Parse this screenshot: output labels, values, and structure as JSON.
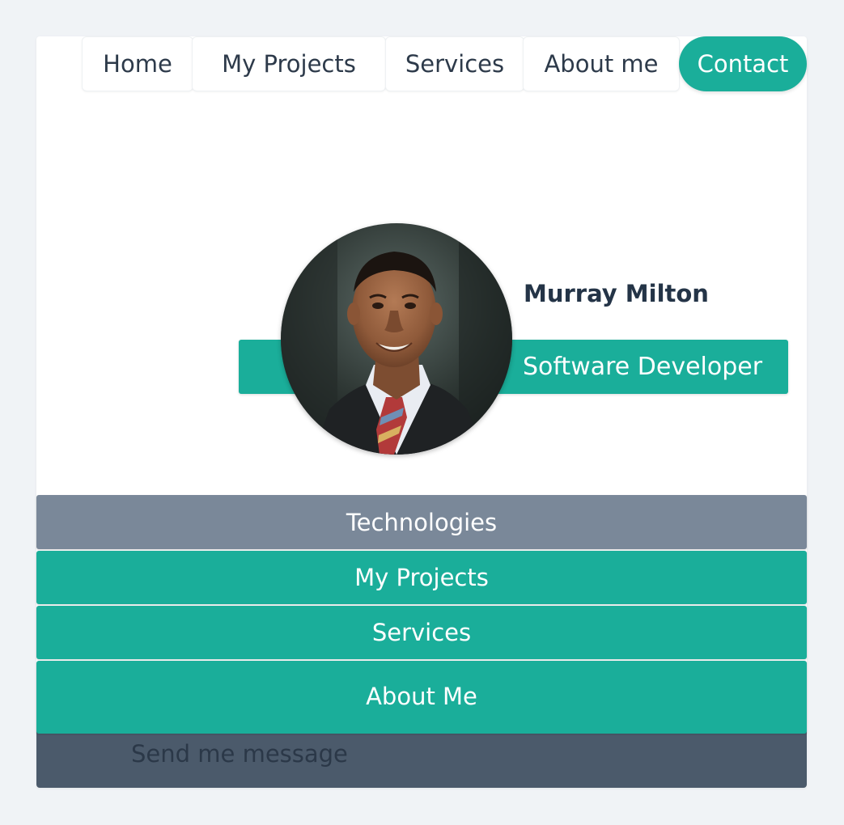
{
  "nav": {
    "items": [
      {
        "label": "Home",
        "active": false
      },
      {
        "label": "My Projects",
        "active": false
      },
      {
        "label": "Services",
        "active": false
      },
      {
        "label": "About me",
        "active": false
      },
      {
        "label": "Contact",
        "active": true
      }
    ]
  },
  "profile": {
    "name": "Murray Milton",
    "role": "Software Developer",
    "avatar_icon": "profile-photo"
  },
  "sections": {
    "technologies": "Technologies",
    "projects": "My Projects",
    "services": "Services",
    "about": "About Me"
  },
  "message": {
    "label": "Send me message"
  },
  "colors": {
    "accent": "#1aae9a",
    "muted_button": "#7a8899",
    "dark_panel": "#4b5a6b",
    "page_bg": "#f0f3f6"
  }
}
